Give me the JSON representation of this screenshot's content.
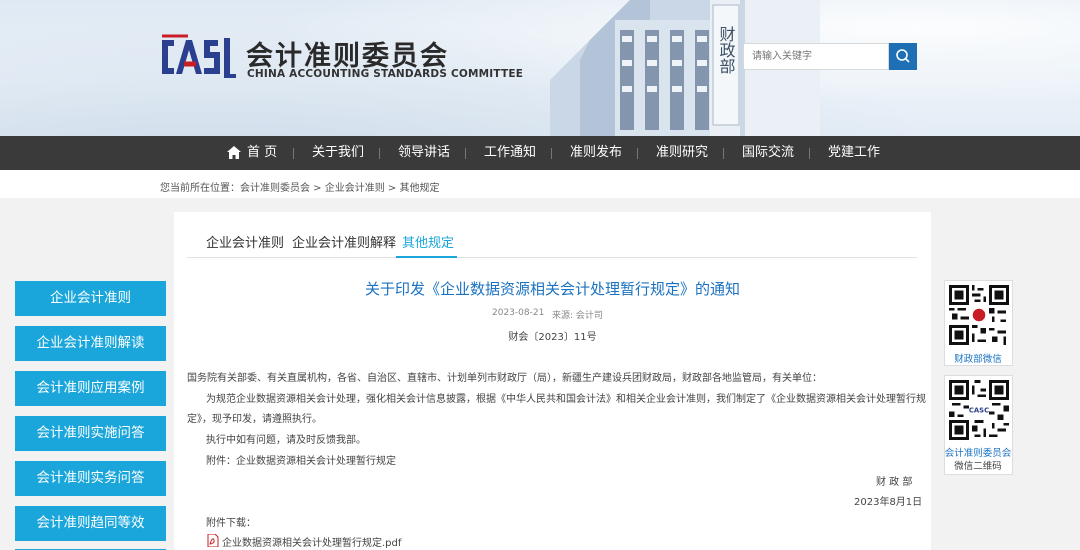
{
  "header": {
    "site_title_cn": "会计准则委员会",
    "site_title_en": "CHINA ACCOUNTING STANDARDS COMMITTEE",
    "building_plaque": "财政部",
    "search_placeholder": "请输入关键字",
    "search_icon": "magnifier-icon"
  },
  "nav": {
    "items": [
      "首 页",
      "关于我们",
      "领导讲话",
      "工作通知",
      "准则发布",
      "准则研究",
      "国际交流",
      "党建工作"
    ]
  },
  "breadcrumb": {
    "prefix": "您当前所在位置：",
    "path": "会计准则委员会 > 企业会计准则 > 其他规定"
  },
  "sidebar": {
    "items": [
      "企业会计准则",
      "企业会计准则解读",
      "会计准则应用案例",
      "会计准则实施问答",
      "会计准则实务问答",
      "会计准则趋同等效"
    ]
  },
  "tabs": {
    "items": [
      "企业会计准则",
      "企业会计准则解释",
      "其他规定"
    ],
    "active": "其他规定"
  },
  "article": {
    "title": "关于印发《企业数据资源相关会计处理暂行规定》的通知",
    "date": "2023-08-21",
    "source": "来源: 会计司",
    "doc_number": "财会〔2023〕11号",
    "recipients": "国务院有关部委、有关直属机构，各省、自治区、直辖市、计划单列市财政厅（局），新疆生产建设兵团财政局，财政部各地监管局，有关单位：",
    "body_line1": "为规范企业数据资源相关会计处理，强化相关会计信息披露，根据《中华人民共和国会计法》和相关企业会计准则，我们制定了《企业数据资源相关会计处理暂行规",
    "body_line2": "定》，现予印发，请遵照执行。",
    "body_line3": "执行中如有问题，请及时反馈我部。",
    "attachment_line": "附件：企业数据资源相关会计处理暂行规定",
    "signature": "财 政 部",
    "sign_date": "2023年8月1日",
    "download_label": "附件下载：",
    "download_file": "企业数据资源相关会计处理暂行规定.pdf"
  },
  "qr": {
    "caption1": "财政部微信",
    "caption2_line1": "会计准则委员会",
    "caption2_line2": "微信二维码"
  },
  "colors": {
    "accent": "#1aa6db",
    "title_blue": "#1a72c2",
    "nav_bg": "#3a3a3a",
    "logo_blue": "#2b3f8f",
    "logo_red": "#c81d25"
  }
}
